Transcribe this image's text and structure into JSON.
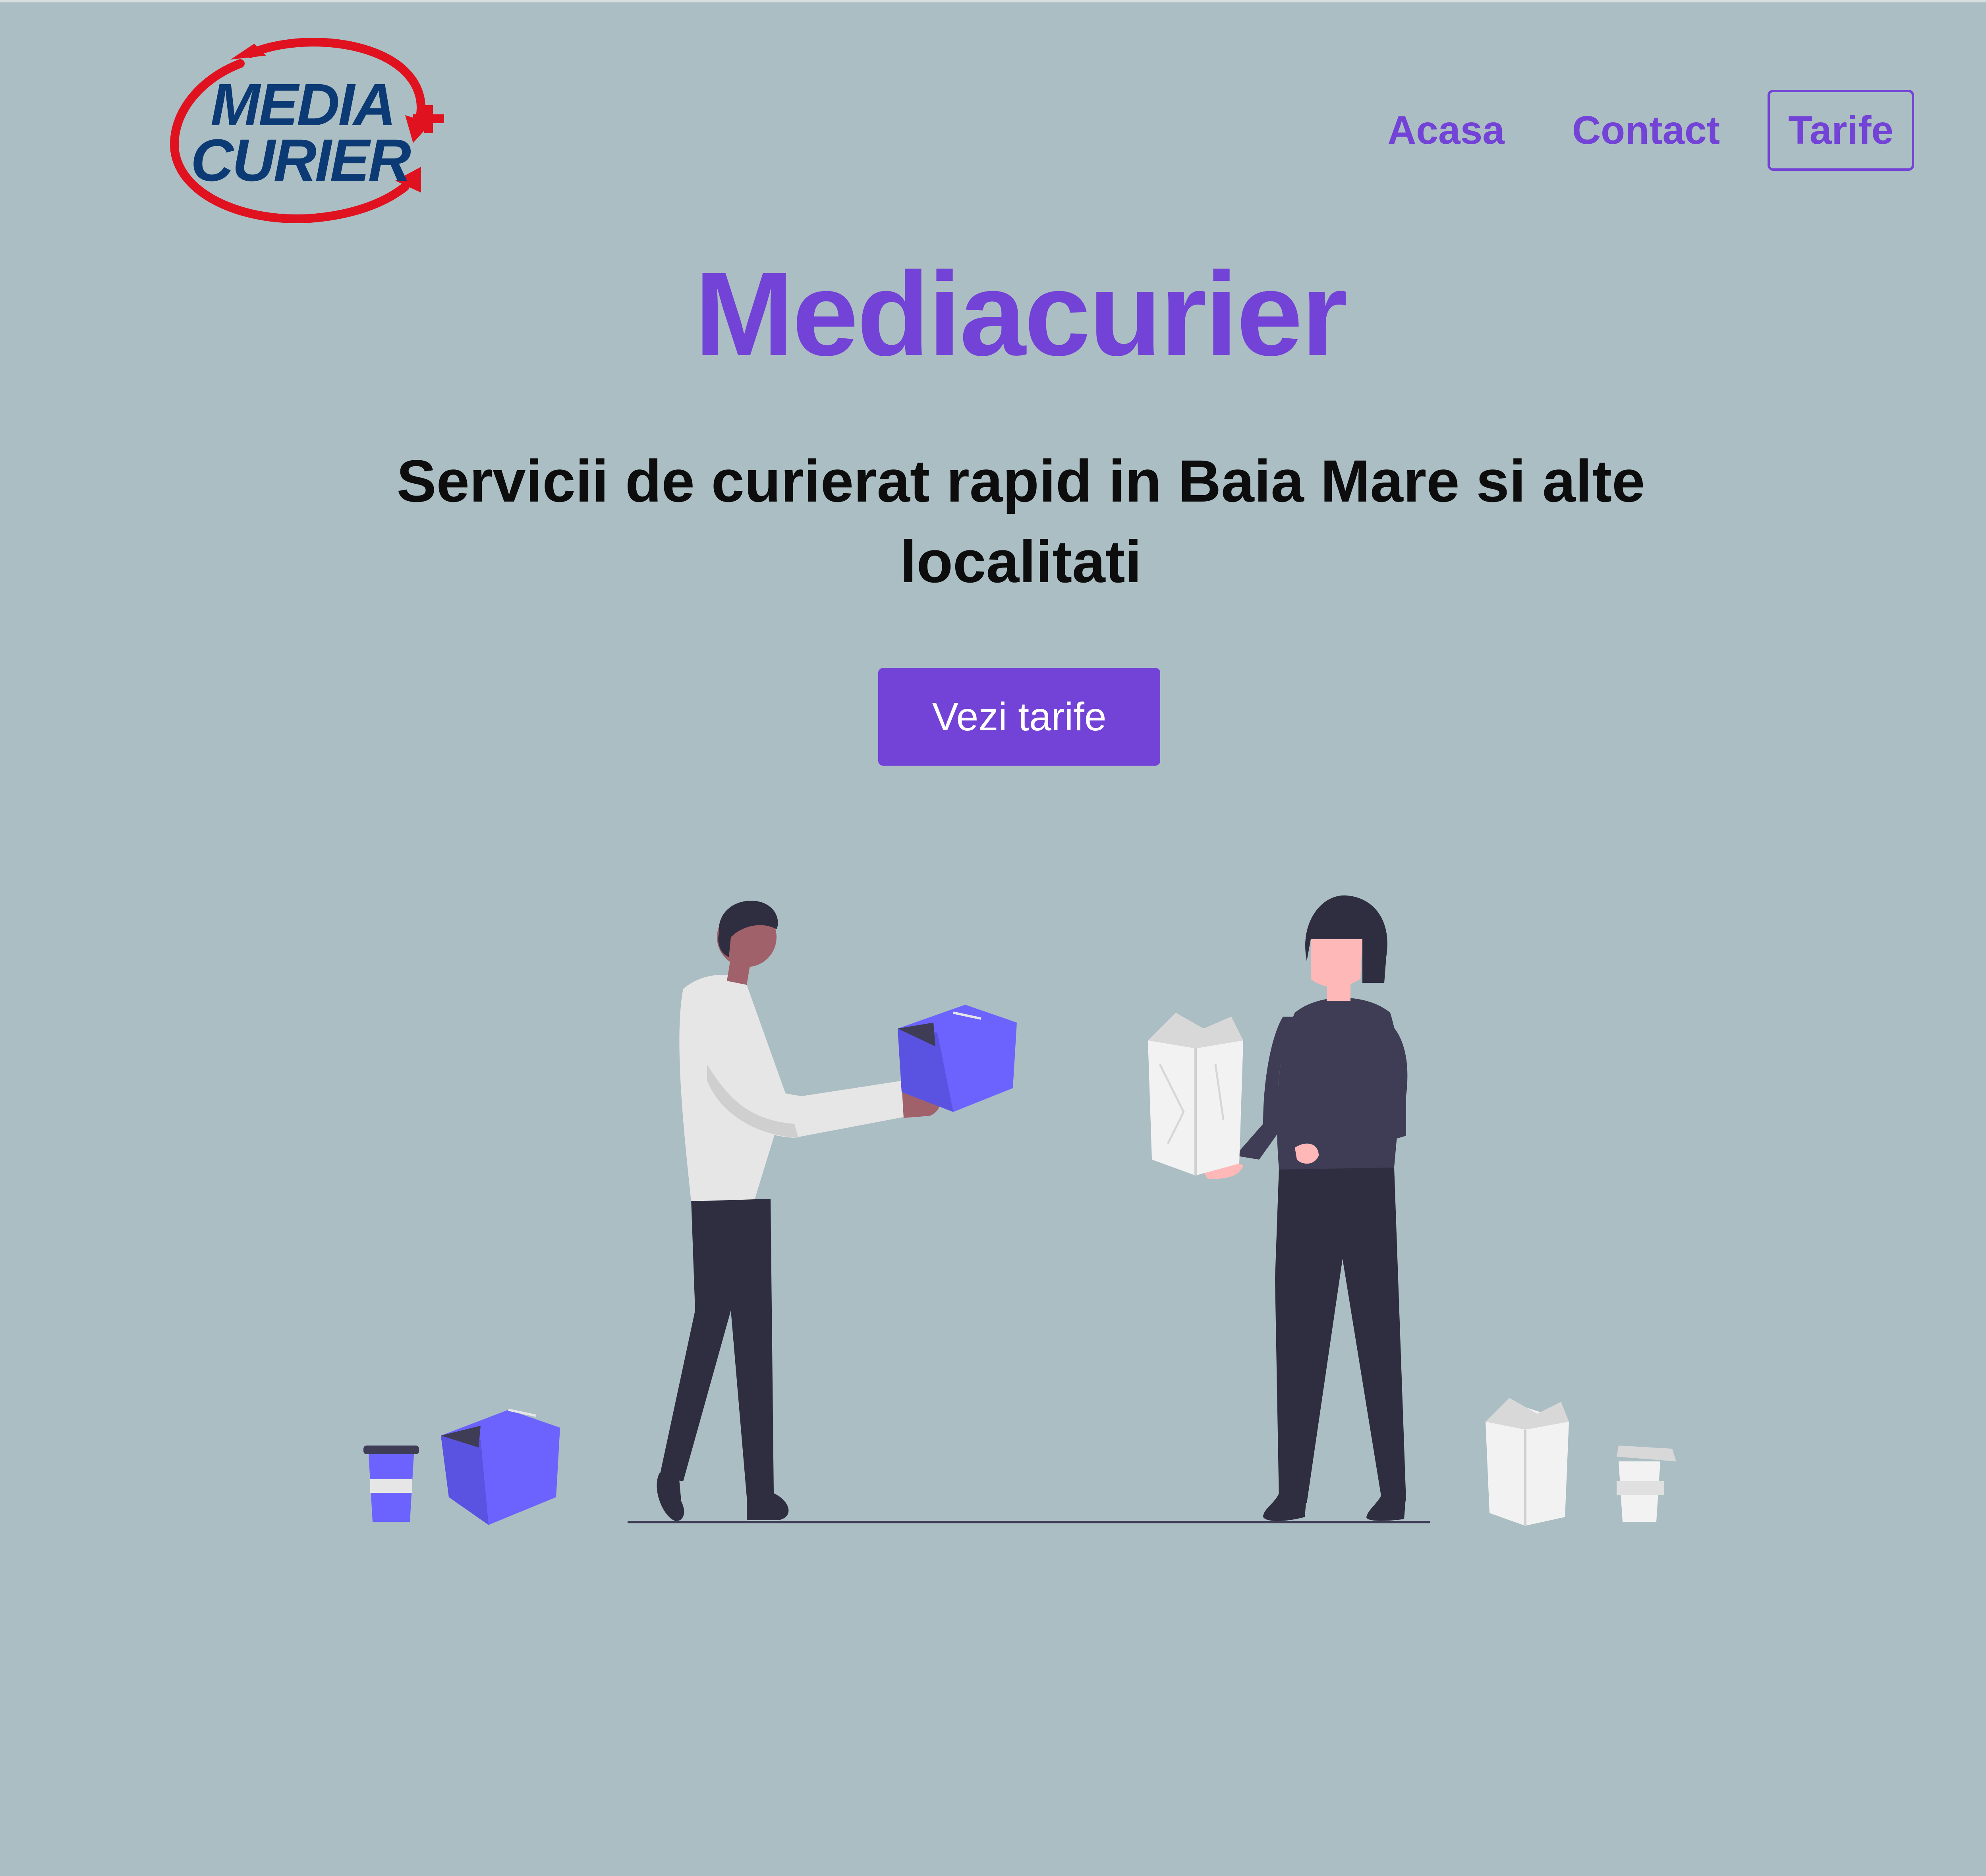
{
  "header": {
    "logo": {
      "line1": "MEDIA",
      "line2": "CURIER"
    },
    "nav": [
      {
        "label": "Acasa"
      },
      {
        "label": "Contact"
      },
      {
        "label": "Tarife"
      }
    ]
  },
  "hero": {
    "title": "Mediacurier",
    "subtitle": "Servicii de curierat rapid in Baia Mare si alte localitati",
    "cta_label": "Vezi tarife"
  },
  "colors": {
    "background": "#abbec3",
    "accent": "#7342d6",
    "logo_blue": "#0b3a75",
    "logo_red": "#e0121f",
    "box_purple": "#6c63ff"
  },
  "icons": {
    "logo": "mediacurier-logo",
    "illustration": "delivery-people-illustration"
  }
}
